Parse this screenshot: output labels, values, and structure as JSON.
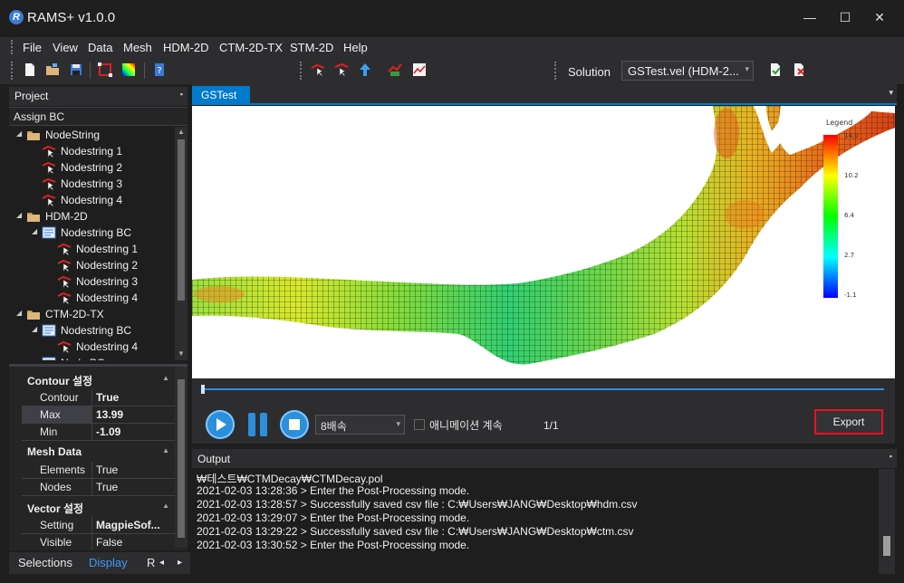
{
  "app": {
    "title": "RAMS+ v1.0.0",
    "logo_letter": "R"
  },
  "window": {
    "minimize": "—",
    "maximize": "☐",
    "close": "✕"
  },
  "menu": {
    "items": [
      "File",
      "View",
      "Data",
      "Mesh",
      "HDM-2D",
      "CTM-2D-TX",
      "STM-2D",
      "Help"
    ]
  },
  "toolbar": {
    "solution_label": "Solution",
    "solution_value": "GSTest.vel (HDM-2...",
    "dropdown_arrow": "▾"
  },
  "project": {
    "title": "Project",
    "pin": "▪",
    "assign_bc": "Assign BC",
    "tree": [
      {
        "label": "NodeString",
        "icon": "folder-icon",
        "depth": 0,
        "expand": "◢"
      },
      {
        "label": "Nodestring 1",
        "icon": "nodestring-icon",
        "depth": 1
      },
      {
        "label": "Nodestring 2",
        "icon": "nodestring-icon",
        "depth": 1
      },
      {
        "label": "Nodestring 3",
        "icon": "nodestring-icon",
        "depth": 1
      },
      {
        "label": "Nodestring 4",
        "icon": "nodestring-icon",
        "depth": 1
      },
      {
        "label": "HDM-2D",
        "icon": "folder-icon",
        "depth": 0,
        "expand": "◢"
      },
      {
        "label": "Nodestring BC",
        "icon": "bc-icon",
        "depth": 1,
        "expand": "◢"
      },
      {
        "label": "Nodestring 1",
        "icon": "nodestring-icon",
        "depth": 2
      },
      {
        "label": "Nodestring 2",
        "icon": "nodestring-icon",
        "depth": 2
      },
      {
        "label": "Nodestring 3",
        "icon": "nodestring-icon",
        "depth": 2
      },
      {
        "label": "Nodestring 4",
        "icon": "nodestring-icon",
        "depth": 2
      },
      {
        "label": "CTM-2D-TX",
        "icon": "folder-icon",
        "depth": 0,
        "expand": "◢"
      },
      {
        "label": "Nodestring BC",
        "icon": "bc-icon",
        "depth": 1,
        "expand": "◢"
      },
      {
        "label": "Nodestring 4",
        "icon": "nodestring-icon",
        "depth": 2
      },
      {
        "label": "Node BC",
        "icon": "bc-icon",
        "depth": 1
      }
    ]
  },
  "properties": {
    "categories": [
      {
        "title": "Contour 설정",
        "rows": [
          {
            "key": "Contour",
            "value": "True",
            "bold": true
          },
          {
            "key": "Max",
            "value": "13.99",
            "bold": true,
            "selected": true
          },
          {
            "key": "Min",
            "value": "-1.09",
            "bold": true
          }
        ]
      },
      {
        "title": "Mesh Data",
        "rows": [
          {
            "key": "Elements",
            "value": "True",
            "bold": false
          },
          {
            "key": "Nodes",
            "value": "True",
            "bold": false
          }
        ]
      },
      {
        "title": "Vector 설정",
        "rows": [
          {
            "key": "Setting",
            "value": "MagpieSof...",
            "bold": true
          },
          {
            "key": "Visible",
            "value": "False",
            "bold": false
          }
        ]
      }
    ],
    "collapse_glyph": "▲"
  },
  "bottom_tabs": {
    "selections": "Selections",
    "display": "Display",
    "more": "R",
    "left": "◂",
    "right": "▸"
  },
  "document": {
    "tab": "GSTest",
    "menu_glyph": "▾"
  },
  "legend": {
    "title": "Legend",
    "ticks": [
      "14.0",
      "10.2",
      "6.4",
      "2.7",
      "-1.1"
    ],
    "colors": [
      "#ff0000",
      "#ffff00",
      "#00ff00",
      "#00ffff",
      "#0000ff"
    ]
  },
  "animation": {
    "speed": "8배속",
    "loop_label": "애니메이션 계속",
    "loop_checked": false,
    "frame": "1/1",
    "export": "Export",
    "progress": 0.0
  },
  "output": {
    "title": "Output",
    "lines": [
      "₩테스트₩CTMDecay₩CTMDecay.pol",
      "2021-02-03 13:28:36 > Enter the Post-Processing mode.",
      "2021-02-03 13:28:57 > Successfully saved csv file : C:₩Users₩JANG₩Desktop₩hdm.csv",
      "2021-02-03 13:29:07 > Enter the Post-Processing mode.",
      "2021-02-03 13:29:22 > Successfully saved csv file : C:₩Users₩JANG₩Desktop₩ctm.csv",
      "2021-02-03 13:30:52 > Enter the Post-Processing mode."
    ]
  },
  "colors": {
    "accent": "#007acc",
    "export_border": "#e81123",
    "panel": "#2d2d30",
    "background": "#1e1e1e"
  }
}
